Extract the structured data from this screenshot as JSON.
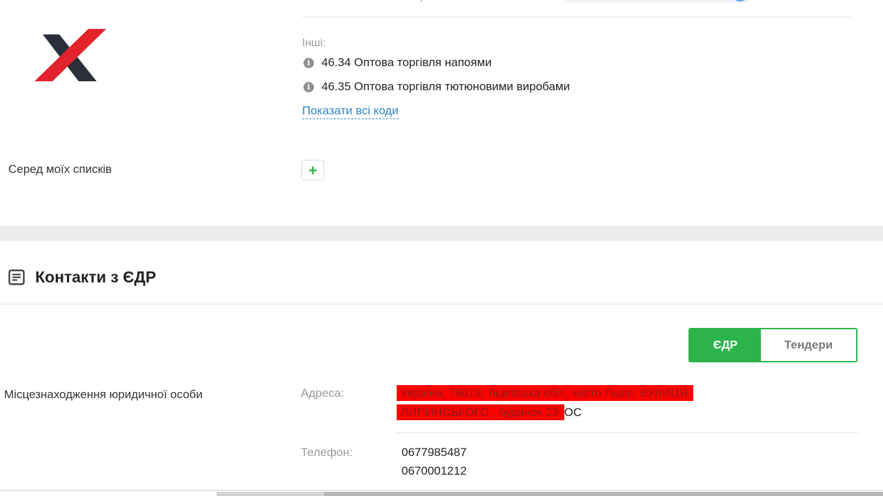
{
  "logo": {
    "name": "x-logo",
    "colors": {
      "primary": "#e3232c",
      "secondary": "#2b2f3a"
    }
  },
  "activities": {
    "others_label": "Інші:",
    "items": [
      {
        "code": "46.34",
        "label": "46.34 Оптова торгівля напоями"
      },
      {
        "code": "46.35",
        "label": "46.35 Оптова торгівля тютюновими виробами"
      }
    ],
    "show_all_link": "Показати всі коди"
  },
  "lists": {
    "label": "Серед моїх списків",
    "add_button": "+"
  },
  "contacts": {
    "title": "Контакти з ЄДР",
    "toggle": {
      "edr": "ЄДР",
      "tenders": "Тендери",
      "active": "ЄДР"
    },
    "location_label": "Місцезнаходження юридичної особи",
    "address_label": "Адреса:",
    "address_line1": "Україна, 79019, Львівська обл., місто Львів, ВУЛИЦЯ",
    "address_line2": "ЛИПИНСЬКОГО , будинок 23",
    "address_tail": "ОС",
    "phone_label": "Телефон:",
    "phones": [
      "0677985487",
      "0670001212"
    ]
  },
  "colors": {
    "accent_green": "#2cb34a",
    "link_blue": "#2f87c9",
    "highlight_red": "#ff0000"
  }
}
